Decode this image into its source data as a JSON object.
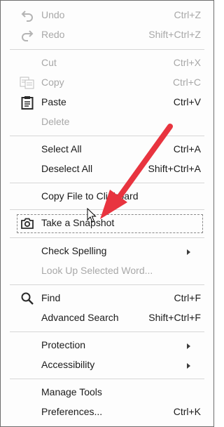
{
  "menu": {
    "undo": {
      "label": "Undo",
      "shortcut": "Ctrl+Z"
    },
    "redo": {
      "label": "Redo",
      "shortcut": "Shift+Ctrl+Z"
    },
    "cut": {
      "label": "Cut",
      "shortcut": "Ctrl+X"
    },
    "copy": {
      "label": "Copy",
      "shortcut": "Ctrl+C"
    },
    "paste": {
      "label": "Paste",
      "shortcut": "Ctrl+V"
    },
    "delete": {
      "label": "Delete"
    },
    "select_all": {
      "label": "Select All",
      "shortcut": "Ctrl+A"
    },
    "deselect_all": {
      "label": "Deselect All",
      "shortcut": "Shift+Ctrl+A"
    },
    "copy_file": {
      "label": "Copy File to Clipboard"
    },
    "snapshot": {
      "label": "Take a Snapshot"
    },
    "check_spelling": {
      "label": "Check Spelling"
    },
    "look_up": {
      "label": "Look Up Selected Word..."
    },
    "find": {
      "label": "Find",
      "shortcut": "Ctrl+F"
    },
    "advanced_search": {
      "label": "Advanced Search",
      "shortcut": "Shift+Ctrl+F"
    },
    "protection": {
      "label": "Protection"
    },
    "accessibility": {
      "label": "Accessibility"
    },
    "manage_tools": {
      "label": "Manage Tools"
    },
    "preferences": {
      "label": "Preferences...",
      "shortcut": "Ctrl+K"
    }
  },
  "colors": {
    "annotation_arrow": "#e8343f",
    "disabled_text": "#a8a8a8",
    "separator": "#d6d6d6"
  }
}
